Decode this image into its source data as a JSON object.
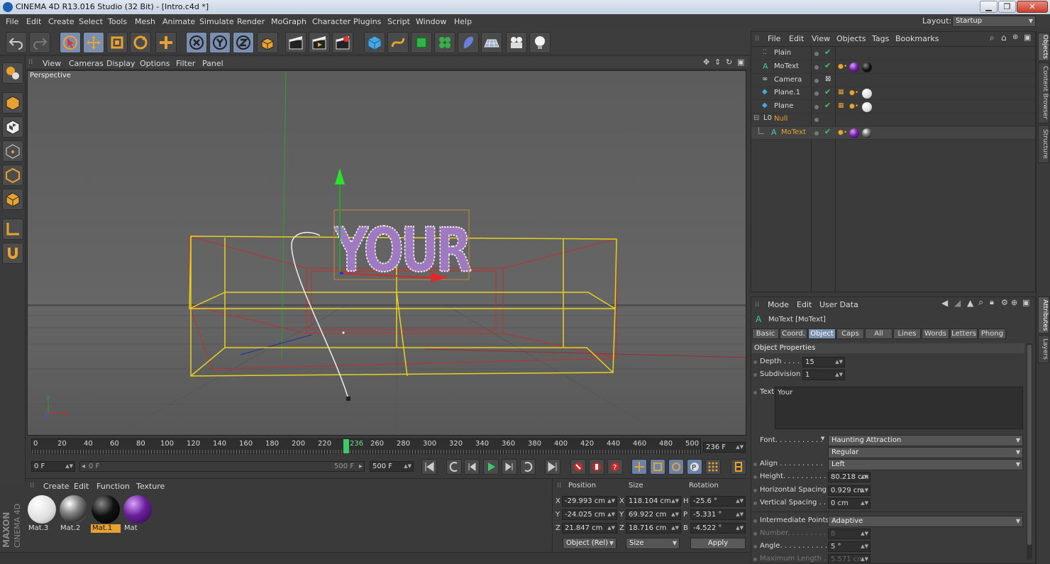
{
  "window": {
    "title": "CINEMA 4D R13.016 Studio (32 Bit) - [Intro.c4d *]",
    "controls": [
      "▁",
      "❐",
      "✕"
    ]
  },
  "menu": [
    "File",
    "Edit",
    "Create",
    "Select",
    "Tools",
    "Mesh",
    "Animate",
    "Simulate",
    "Render",
    "MoGraph",
    "Character",
    "Plugins",
    "Script",
    "Window",
    "Help"
  ],
  "layout": {
    "label": "Layout:",
    "value": "Startup"
  },
  "viewport": {
    "menu": [
      "View",
      "Cameras",
      "Display",
      "Options",
      "Filter",
      "Panel"
    ],
    "label": "Perspective",
    "text_object": "YOUR",
    "axis_y": "Y",
    "axis_x": "X"
  },
  "timeline": {
    "ticks": [
      "0",
      "20",
      "40",
      "60",
      "80",
      "100",
      "120",
      "140",
      "160",
      "180",
      "200",
      "220",
      "236",
      "260",
      "280",
      "300",
      "320",
      "340",
      "360",
      "380",
      "400",
      "420",
      "440",
      "460",
      "480",
      "500"
    ],
    "current_frame": "236 F",
    "start_field": "0 F",
    "range_start": "0 F",
    "range_end": "500 F",
    "end_field": "500 F"
  },
  "materials": {
    "menu": [
      "Create",
      "Edit",
      "Function",
      "Texture"
    ],
    "items": [
      {
        "label": "Mat.3",
        "color": "#ffffff"
      },
      {
        "label": "Mat.2",
        "color": "#9a9a9a"
      },
      {
        "label": "Mat.1",
        "color": "#111111"
      },
      {
        "label": "Mat",
        "color": "#6a1f9a"
      }
    ]
  },
  "coordinates": {
    "headers": [
      "Position",
      "Size",
      "Rotation"
    ],
    "rows": [
      {
        "axis": "X",
        "pos": "-29.993 cm",
        "size_axis": "X",
        "size": "118.104 cm",
        "rot_axis": "H",
        "rot": "-25.6 °"
      },
      {
        "axis": "Y",
        "pos": "-24.025 cm",
        "size_axis": "Y",
        "size": "69.922 cm",
        "rot_axis": "P",
        "rot": "-5.331 °"
      },
      {
        "axis": "Z",
        "pos": "21.847 cm",
        "size_axis": "Z",
        "size": "18.716 cm",
        "rot_axis": "B",
        "rot": "-4.522 °"
      }
    ],
    "mode": "Object (Rel)",
    "size_mode": "Size",
    "apply": "Apply"
  },
  "objects": {
    "menu": [
      "File",
      "Edit",
      "View",
      "Objects",
      "Tags",
      "Bookmarks"
    ],
    "rows": [
      {
        "name": "Plain",
        "indent": 0
      },
      {
        "name": "MoText",
        "indent": 0
      },
      {
        "name": "Camera",
        "indent": 0
      },
      {
        "name": "Plane.1",
        "indent": 0
      },
      {
        "name": "Plane",
        "indent": 0
      },
      {
        "name": "Null",
        "indent": 0
      },
      {
        "name": "MoText",
        "indent": 1
      }
    ]
  },
  "attributes": {
    "menu": [
      "Mode",
      "Edit",
      "User Data"
    ],
    "object_title": "MoText [MoText]",
    "tabs": [
      "Basic",
      "Coord.",
      "Object",
      "Caps",
      "All",
      "Lines",
      "Words",
      "Letters",
      "Phong"
    ],
    "active_tab": "Object",
    "section": "Object Properties",
    "depth": {
      "label": "Depth . . . .",
      "value": "15"
    },
    "subdivision": {
      "label": "Subdivision",
      "value": "1"
    },
    "text": {
      "label": "Text",
      "value": "Your"
    },
    "font": {
      "label": "Font. . . . . . . . . . .",
      "value": "Haunting Attraction",
      "style": "Regular"
    },
    "align": {
      "label": "Align . . . . . . . . . .",
      "value": "Left"
    },
    "height": {
      "label": "Height. . . . . . . . . .",
      "value": "80.218 cm"
    },
    "hspacing": {
      "label": "Horizontal Spacing",
      "value": "0.929 cm"
    },
    "vspacing": {
      "label": "Vertical Spacing . .",
      "value": "0 cm"
    },
    "intermediate": {
      "label": "Intermediate Points",
      "value": "Adaptive"
    },
    "number": {
      "label": "Number. . . . . . . . .",
      "value": "8"
    },
    "angle": {
      "label": "Angle. . . . . . . . . . .",
      "value": "5 °"
    },
    "maxlen": {
      "label": "Maximum Length . .",
      "value": "5.571 cm"
    }
  },
  "side_tabs": [
    "Objects",
    "Content Browser",
    "Structure",
    "Attributes",
    "Layers"
  ],
  "brand": {
    "line1": "MAXON",
    "line2": "CINEMA 4D"
  }
}
